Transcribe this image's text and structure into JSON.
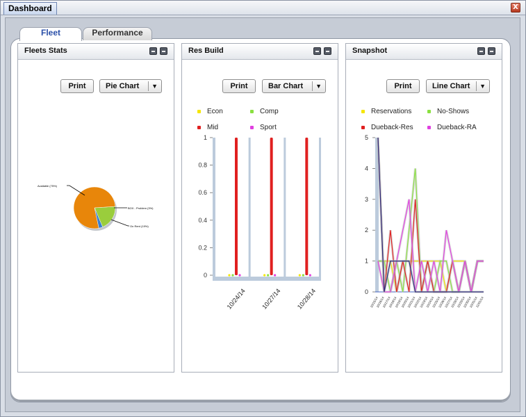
{
  "window": {
    "title": "Dashboard",
    "close_symbol": "X"
  },
  "tabs": [
    {
      "label": "Fleet",
      "active": true
    },
    {
      "label": "Performance",
      "active": false
    }
  ],
  "panels": {
    "fleets": {
      "title": "Fleets Stats",
      "print_label": "Print",
      "chart_select": "Pie Chart"
    },
    "resbuild": {
      "title": "Res Build",
      "print_label": "Print",
      "chart_select": "Bar Chart"
    },
    "snapshot": {
      "title": "Snapshot",
      "print_label": "Print",
      "chart_select": "Line Chart"
    }
  },
  "colors": {
    "accent": "#2a4fa8",
    "orange": "#e8860a",
    "green": "#9acd3c",
    "blue": "#3a7fd0",
    "red": "#e02020",
    "yellow": "#f5e600",
    "lime": "#8ae040",
    "magenta": "#e040e0"
  },
  "chart_data": [
    {
      "type": "pie",
      "labels": [
        "Available (75%)",
        "BOX - Problem (3%)",
        "On Rent (19%)"
      ],
      "values": [
        75,
        3,
        19
      ],
      "colors": [
        "#e8860a",
        "#3a7fd0",
        "#9acd3c"
      ]
    },
    {
      "type": "bar",
      "categories": [
        "10/24/14",
        "10/27/14",
        "10/28/14"
      ],
      "series": [
        {
          "name": "Econ",
          "values": [
            0,
            0,
            0
          ],
          "color": "#f5e600"
        },
        {
          "name": "Comp",
          "values": [
            0,
            0,
            0
          ],
          "color": "#8ae040"
        },
        {
          "name": "Mid",
          "values": [
            1,
            1,
            1
          ],
          "color": "#e02020"
        },
        {
          "name": "Sport",
          "values": [
            0,
            0,
            0
          ],
          "color": "#e040e0"
        }
      ],
      "yticks": [
        "0",
        "0.2",
        "0.4",
        "0.6",
        "0.8",
        "1"
      ],
      "ylim": [
        0,
        1
      ]
    },
    {
      "type": "line",
      "x": [
        "10/15/14",
        "10/16/14",
        "10/17/14",
        "10/18/14",
        "10/19/14",
        "10/20/14",
        "10/21/14",
        "10/22/14",
        "10/23/14",
        "10/24/14",
        "10/25/14",
        "10/26/14",
        "10/27/14",
        "10/28/14",
        "10/29/14",
        "10/30/14",
        "10/31/14",
        "11/01/14"
      ],
      "xticks": [
        "10/15/14",
        "10/16/14",
        "10/17/14",
        "10/18/14",
        "10/19/14",
        "10/20/14",
        "10/21/14",
        "10/22/14",
        "10/23/14",
        "10/24/14",
        "10/25/14",
        "10/26/14",
        "10/27/14",
        "10/28/14",
        "10/29/14",
        "10/30/14",
        "10/31/14",
        "11/01/14"
      ],
      "series": [
        {
          "name": "Reservations",
          "color": "#f5e600",
          "values": [
            1,
            1,
            1,
            0,
            1,
            1,
            1,
            1,
            1,
            1,
            1,
            0,
            1,
            1,
            1,
            0,
            1,
            1
          ]
        },
        {
          "name": "No-Shows",
          "color": "#8ae040",
          "values": [
            1,
            1,
            0,
            1,
            0,
            2,
            4,
            0,
            1,
            0,
            1,
            1,
            0,
            0,
            1,
            0,
            1,
            1
          ]
        },
        {
          "name": "Dueback-Res",
          "color": "#e02020",
          "values": [
            5,
            0,
            2,
            0,
            1,
            0,
            3,
            0,
            1,
            0,
            0,
            0,
            1,
            0,
            1,
            0,
            1,
            1
          ]
        },
        {
          "name": "Dueback-RA",
          "color": "#e040e0",
          "values": [
            1,
            0,
            0,
            1,
            2,
            3,
            0,
            1,
            0,
            1,
            0,
            2,
            1,
            0,
            1,
            0,
            1,
            1
          ]
        },
        {
          "name": "",
          "color": "#2a2a7a",
          "values": [
            5,
            0,
            1,
            1,
            1,
            1,
            0,
            0,
            0,
            0,
            0,
            0,
            0,
            0,
            0,
            0,
            0,
            0
          ]
        }
      ],
      "yticks": [
        "0",
        "1",
        "2",
        "3",
        "4",
        "5"
      ],
      "ylim": [
        0,
        5
      ]
    }
  ]
}
